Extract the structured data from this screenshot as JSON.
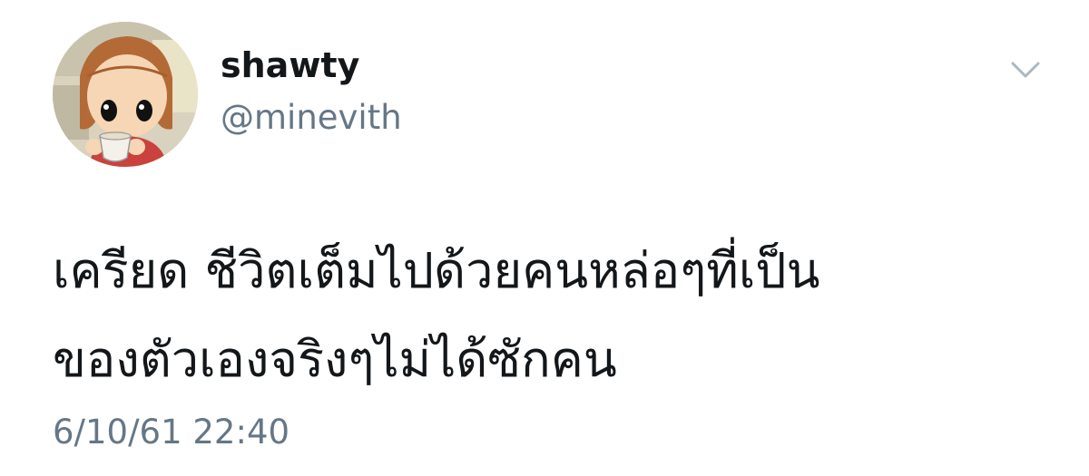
{
  "user": {
    "display_name": "shawty",
    "handle": "@minevith"
  },
  "tweet": {
    "text_lines": [
      "เครียด ชีวิตเต็มไปด้วยคนหล่อๆที่เป็น",
      "ของตัวเองจริงๆไม่ได้ซักคน"
    ],
    "timestamp": "6/10/61 22:40"
  },
  "icons": {
    "avatar": "cartoon-avatar",
    "menu": "chevron-down-icon"
  },
  "colors": {
    "text_primary": "#14171a",
    "text_secondary": "#657786",
    "chevron": "#aab8c2",
    "background": "#ffffff"
  }
}
